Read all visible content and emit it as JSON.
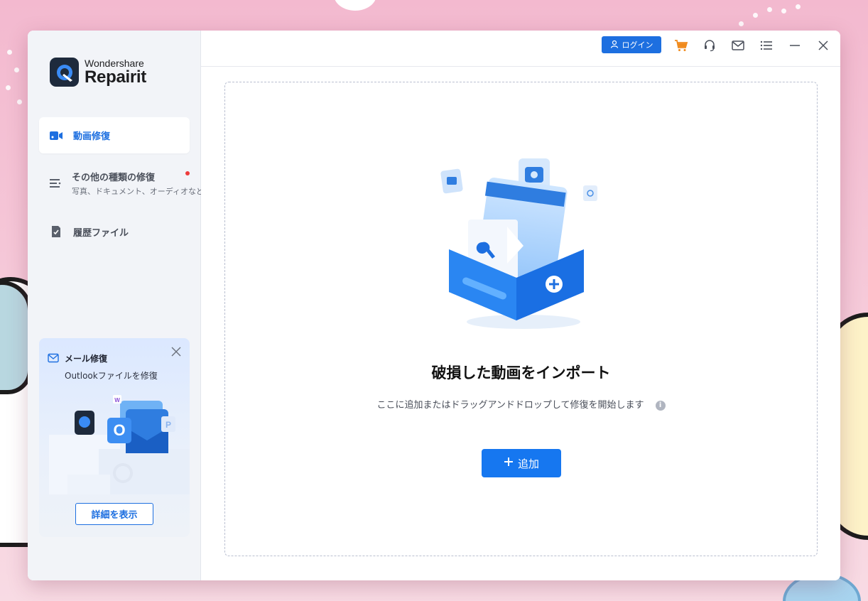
{
  "app": {
    "brand": "Wondershare",
    "name": "Repairit",
    "accent_color": "#1d6fe0"
  },
  "header": {
    "login_label": "ログイン",
    "icons": [
      "cart-icon",
      "headset-icon",
      "mail-icon",
      "menu-list-icon",
      "minimize-icon",
      "close-icon"
    ]
  },
  "sidebar": {
    "items": [
      {
        "label": "動画修復",
        "icon": "video-icon",
        "active": true
      },
      {
        "label": "その他の種類の修復",
        "sublabel": "写真、ドキュメント、オーディオなど。",
        "icon": "list-icon",
        "badge": "red-dot"
      },
      {
        "label": "履歴ファイル",
        "icon": "history-file-icon"
      }
    ]
  },
  "promo": {
    "title": "メール修復",
    "subtitle": "Outlookファイルを修復",
    "button_label": "詳細を表示"
  },
  "dropzone": {
    "title": "破損した動画をインポート",
    "description": "ここに追加またはドラッグアンドドロップして修復を開始します",
    "info_icon": "i",
    "add_button": "追加"
  }
}
